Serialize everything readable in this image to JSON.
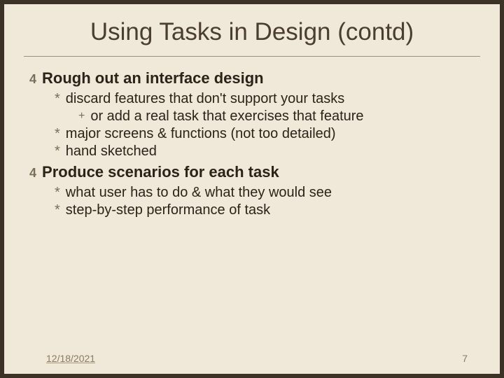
{
  "title": "Using Tasks in Design (contd)",
  "sections": [
    {
      "heading": "Rough out an interface design",
      "items": [
        {
          "text": "discard features that don't support your tasks",
          "sub": [
            {
              "text": "or add a real task that exercises that feature"
            }
          ]
        },
        {
          "text": "major screens & functions (not too detailed)"
        },
        {
          "text": "hand sketched"
        }
      ]
    },
    {
      "heading": "Produce scenarios for each task",
      "items": [
        {
          "text": "what user has to do & what they would see"
        },
        {
          "text": "step-by-step performance of task"
        }
      ]
    }
  ],
  "footer": {
    "date": "12/18/2021",
    "page": "7"
  },
  "bullets": {
    "lvl1": "4",
    "lvl2": "*",
    "lvl3": "+"
  }
}
